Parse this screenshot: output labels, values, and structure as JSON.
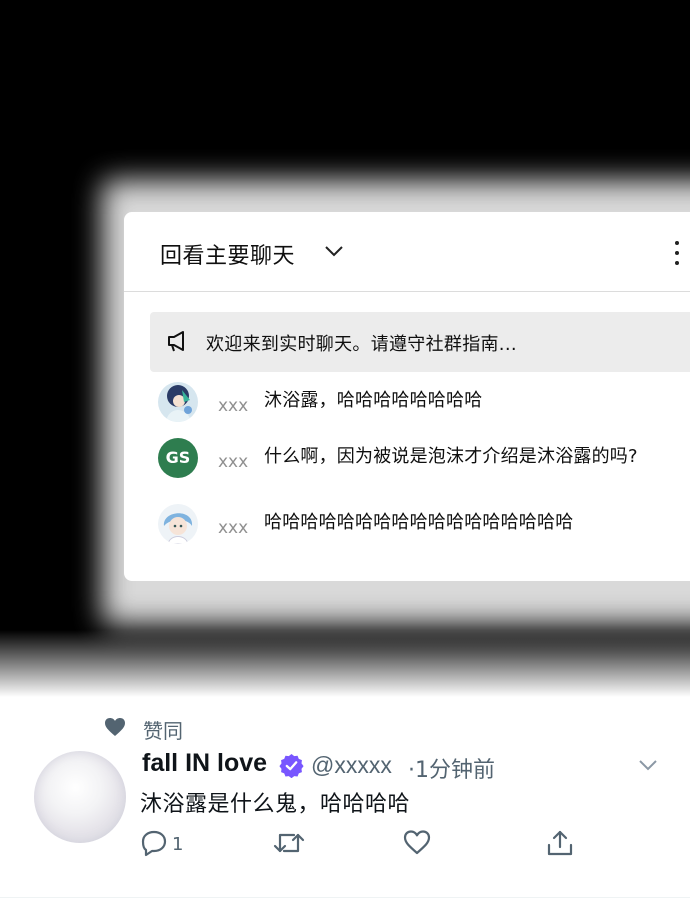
{
  "chat": {
    "title": "回看主要聊天",
    "banner": "欢迎来到实时聊天。请遵守社群指南...",
    "messages": [
      {
        "author": "xxx",
        "text": "沐浴露，哈哈哈哈哈哈哈哈"
      },
      {
        "author": "xxx",
        "avatar_initials": "GS",
        "text": "什么啊，因为被说是泡沫才介绍是沐浴露的吗?"
      },
      {
        "author": "xxx",
        "text": "哈哈哈哈哈哈哈哈哈哈哈哈哈哈哈哈哈"
      }
    ]
  },
  "tweet": {
    "liked_label": "赞同",
    "name": "fall IN love",
    "handle": "@xxxxx",
    "time": "·1分钟前",
    "text": "沐浴露是什么鬼，哈哈哈哈",
    "reply_count": "1",
    "colors": {
      "verified": "#7856ff",
      "secondary": "#536471",
      "gs_avatar": "#2e7d4f"
    }
  }
}
